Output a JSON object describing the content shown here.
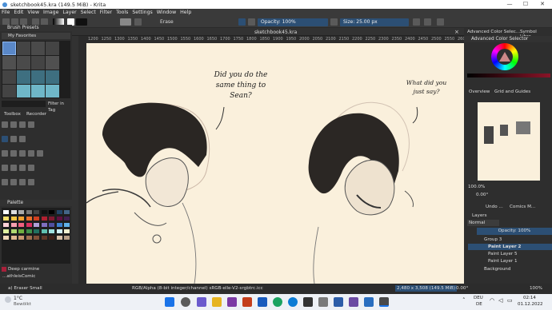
{
  "window": {
    "title": "sketchbook45.kra (149.5 MiB) - Krita",
    "minimize": "—",
    "maximize": "☐",
    "close": "✕"
  },
  "menu": [
    "File",
    "Edit",
    "View",
    "Image",
    "Layer",
    "Select",
    "Filter",
    "Tools",
    "Settings",
    "Window",
    "Help"
  ],
  "toolbar": {
    "brush_name": "Erase",
    "opacity": "Opacity: 100%",
    "size": "Size: 25.00 px"
  },
  "left": {
    "brush_presets_title": "Brush Presets",
    "tag": "My Favorites",
    "filter_in_tag": "Filter in Tag",
    "tabs": [
      "Toolbox",
      "Recorder"
    ],
    "palette_title": "Palette",
    "color_name": "Deep carmine",
    "palette_name": "...athleisComic",
    "brush_status": "a) Eraser Small"
  },
  "canvas": {
    "doc_tab": "sketchbook45.kra",
    "ruler_ticks": [
      "1200",
      "1250",
      "1300",
      "1350",
      "1400",
      "1450",
      "1500",
      "1550",
      "1600",
      "1650",
      "1700",
      "1750",
      "1800",
      "1850",
      "1900",
      "1950",
      "2000",
      "2050",
      "2100",
      "2150",
      "2200",
      "2250",
      "2300",
      "2350",
      "2400",
      "2450",
      "2500",
      "2550",
      "2600"
    ],
    "speech1": [
      "Did you do the",
      "same thing to",
      "Sean?"
    ],
    "speech2": [
      "What did you",
      "just say?"
    ]
  },
  "right": {
    "tabs_top": [
      "Advanced Color Selec...",
      "Symbol Libra..."
    ],
    "acs_title": "Advanced Color Selector",
    "overview_tabs": [
      "Overview",
      "Grid and Guides"
    ],
    "zoom": "100.0%",
    "rotation": "0.00°",
    "tabs_mid": [
      "Undo ...",
      "Comics M...",
      "Layers"
    ],
    "layers_title": "Layers",
    "blend_mode": "Normal",
    "layer_opacity": "Opacity: 100%",
    "layers": [
      "Group 3",
      "Paint Layer 2",
      "Paint Layer 5",
      "Paint Layer 1",
      "Background"
    ]
  },
  "status": {
    "color_space": "RGB/Alpha (8-bit integer/channel)  sRGB-elle-V2-srgbtrc.icc",
    "dims": "2,480 x 3,508 (149.5 MiB)",
    "rotation": "0.00°",
    "zoom": "100%"
  },
  "taskbar": {
    "weather_temp": "1°C",
    "weather_desc": "Bewölkt",
    "lang1": "DEU",
    "lang2": "DE",
    "time": "02:14",
    "date": "01.12.2022"
  },
  "colors": {
    "canvas": "#faf0dc",
    "accent": "#2c4f74",
    "chrome": "#3a3a3a"
  }
}
